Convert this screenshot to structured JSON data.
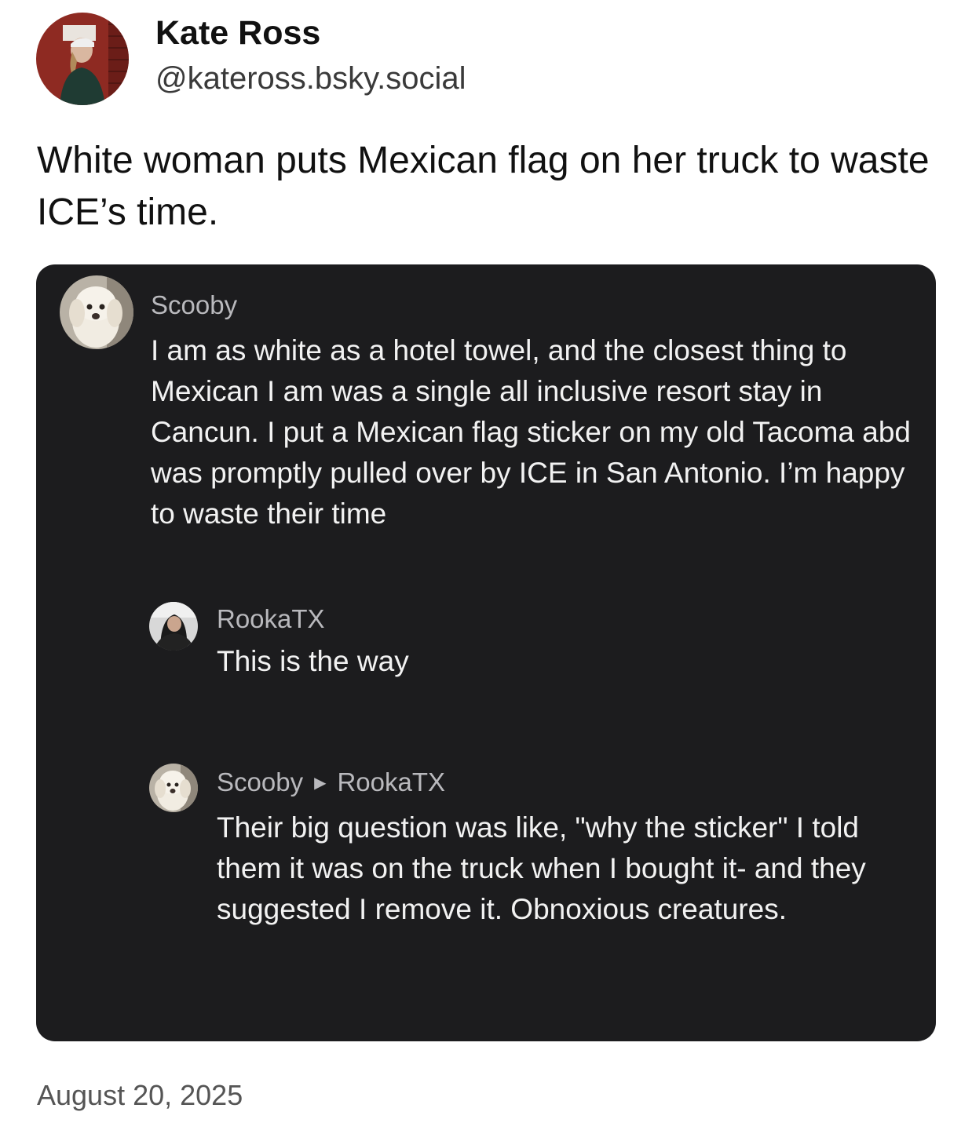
{
  "author": {
    "name": "Kate Ross",
    "handle": "@kateross.bsky.social"
  },
  "post": {
    "text": "White woman puts Mexican flag on her truck to waste ICE’s time.",
    "date": "August 20, 2025"
  },
  "embed": {
    "comments": [
      {
        "name": "Scooby",
        "text": "I am as white as a hotel towel, and the closest thing to Mexican I am was a single all inclusive resort stay in Cancun. I put a Mexican flag sticker on my old Tacoma abd was promptly pulled over by ICE in San Antonio. I’m happy to waste their time"
      },
      {
        "name": "RookaTX",
        "text": "This is the way"
      },
      {
        "name": "Scooby",
        "reply_to": "RookaTX",
        "text": "Their big question was like, \"why the sticker\" I told them it was on the truck when I bought it- and they suggested I remove it. Obnoxious creatures."
      }
    ]
  }
}
